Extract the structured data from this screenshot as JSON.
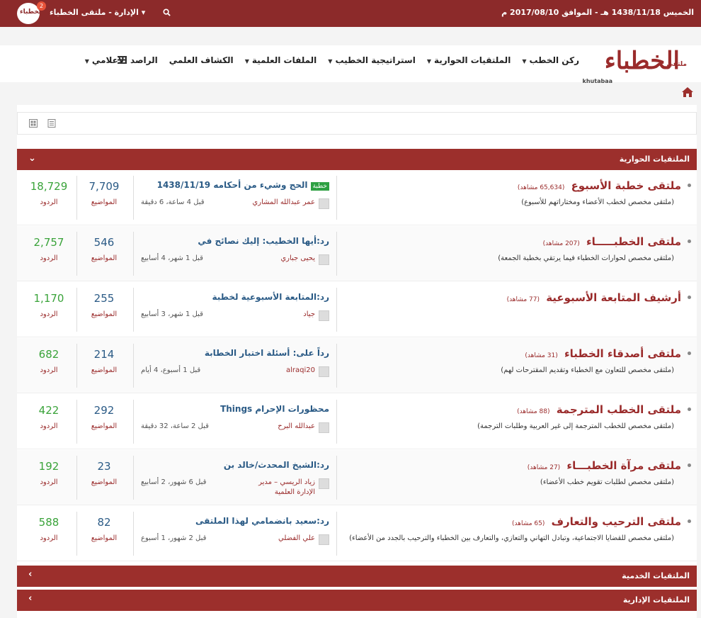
{
  "topbar": {
    "date": "الخميس 1438/11/18 هـ - الموافق 2017/08/10 م",
    "admin_label": "الإدارة - ملتقى الخطباء",
    "logo_text": "الخطباء",
    "notification_count": "2",
    "icons": {
      "search": "search-icon",
      "caret": "caret-down-icon"
    }
  },
  "header": {
    "brand_word": "الخطباء",
    "brand_prefix": "ملتقى",
    "brand_latin": "khutabaa",
    "nav": [
      {
        "label": "ركن الخطب",
        "caret": true
      },
      {
        "label": "الملتقيات الحوارية",
        "caret": true
      },
      {
        "label": "استراتيجية الخطيب",
        "caret": true
      },
      {
        "label": "الملفات العلمية",
        "caret": true
      },
      {
        "label": "الكشاف العلمي",
        "caret": false
      },
      {
        "label": "الراصد الاعلامي",
        "caret": true
      }
    ]
  },
  "sections": [
    {
      "title": "الملتقيات الحوارية",
      "expanded": true
    },
    {
      "title": "الملتقيات الخدمية",
      "expanded": false
    },
    {
      "title": "الملتقيات الإدارية",
      "expanded": false
    }
  ],
  "forums": [
    {
      "title": "ملتقى خطبة الأسبوع",
      "views": "(65,634 مشاهد)",
      "desc": "(ملتقى مخصص لخطب الأعضاء ومختاراتهم للأسبوع)",
      "last_post": {
        "tag": "خطبة",
        "title": "الحج وشيء من أحكامه 1438/11/19",
        "author": "عمر عبدالله المشاري",
        "author2": "",
        "when": "قبل 4 ساعة، 6 دقيقة"
      },
      "topics": "7,709",
      "posts": "18,729"
    },
    {
      "title": "ملتقى الخطبـــــاء",
      "views": "(207 مشاهد)",
      "desc": "(ملتقى مخصص لحوارات الخطباء فيما يرتقي بخطبة الجمعة)",
      "last_post": {
        "tag": "",
        "title": "رد:أيها الخطيب: إليك نصائح في",
        "author": "يحيى جباري",
        "author2": "",
        "when": "قبل 1 شهر، 4 أسابيع"
      },
      "topics": "546",
      "posts": "2,757"
    },
    {
      "title": "أرشيف المتابعة الأسبوعية",
      "views": "(77 مشاهد)",
      "desc": "",
      "last_post": {
        "tag": "",
        "title": "رد:المتابعة الأسبوعية لخطبة",
        "author": "جياد",
        "author2": "",
        "when": "قبل 1 شهر، 3 أسابيع"
      },
      "topics": "255",
      "posts": "1,170"
    },
    {
      "title": "ملتقى أصدقاء الخطباء",
      "views": "(31 مشاهد)",
      "desc": "(ملتقى مخصص للتعاون مع الخطباء وتقديم المقترحات لهم)",
      "last_post": {
        "tag": "",
        "title": "رداً على: أسئلة اختبار الخطابة",
        "author": "alraqi20",
        "author2": "",
        "when": "قبل 1 أسبوع، 4 أيام"
      },
      "topics": "214",
      "posts": "682"
    },
    {
      "title": "ملتقى الخطب المترجمة",
      "views": "(88 مشاهد)",
      "desc": "(ملتقى مخصص للخطب المترجمة إلى غير العربية وطلبات الترجمة)",
      "last_post": {
        "tag": "",
        "title": "محظورات الإحرام Things",
        "author": "عبدالله البرح",
        "author2": "",
        "when": "قبل 2 ساعة، 32 دقيقة"
      },
      "topics": "292",
      "posts": "422"
    },
    {
      "title": "ملتقى مرآة الخطبـــاء",
      "views": "(27 مشاهد)",
      "desc": "(ملتقى مخصص لطلبات تقويم خطب الأعضاء)",
      "last_post": {
        "tag": "",
        "title": "رد:الشيخ المحدث/خالد بن",
        "author": "زياد الريسي – مدير",
        "author2": "الإدارة العلمية",
        "when": "قبل 6 شهور، 2 أسابيع"
      },
      "topics": "23",
      "posts": "192"
    },
    {
      "title": "ملتقى الترحيب والتعارف",
      "views": "(65 مشاهد)",
      "desc": "(ملتقى مخصص للقضايا الاجتماعية، وتبادل التهاني والتعازي، والتعارف بين الخطباء والترحيب بالجدد من الأعضاء)",
      "last_post": {
        "tag": "",
        "title": "رد:سعيد بانضمامي لهذا الملتقى",
        "author": "علي الفضلي",
        "author2": "",
        "when": "قبل 2 شهور، 1 أسبوع"
      },
      "topics": "82",
      "posts": "588"
    }
  ],
  "labels": {
    "topics": "المواضيع",
    "posts": "الردود"
  },
  "colors": {
    "brand": "#9c2f2c",
    "link": "#2b5b86",
    "posts": "#3aa33a",
    "tag": "#2ea043"
  }
}
